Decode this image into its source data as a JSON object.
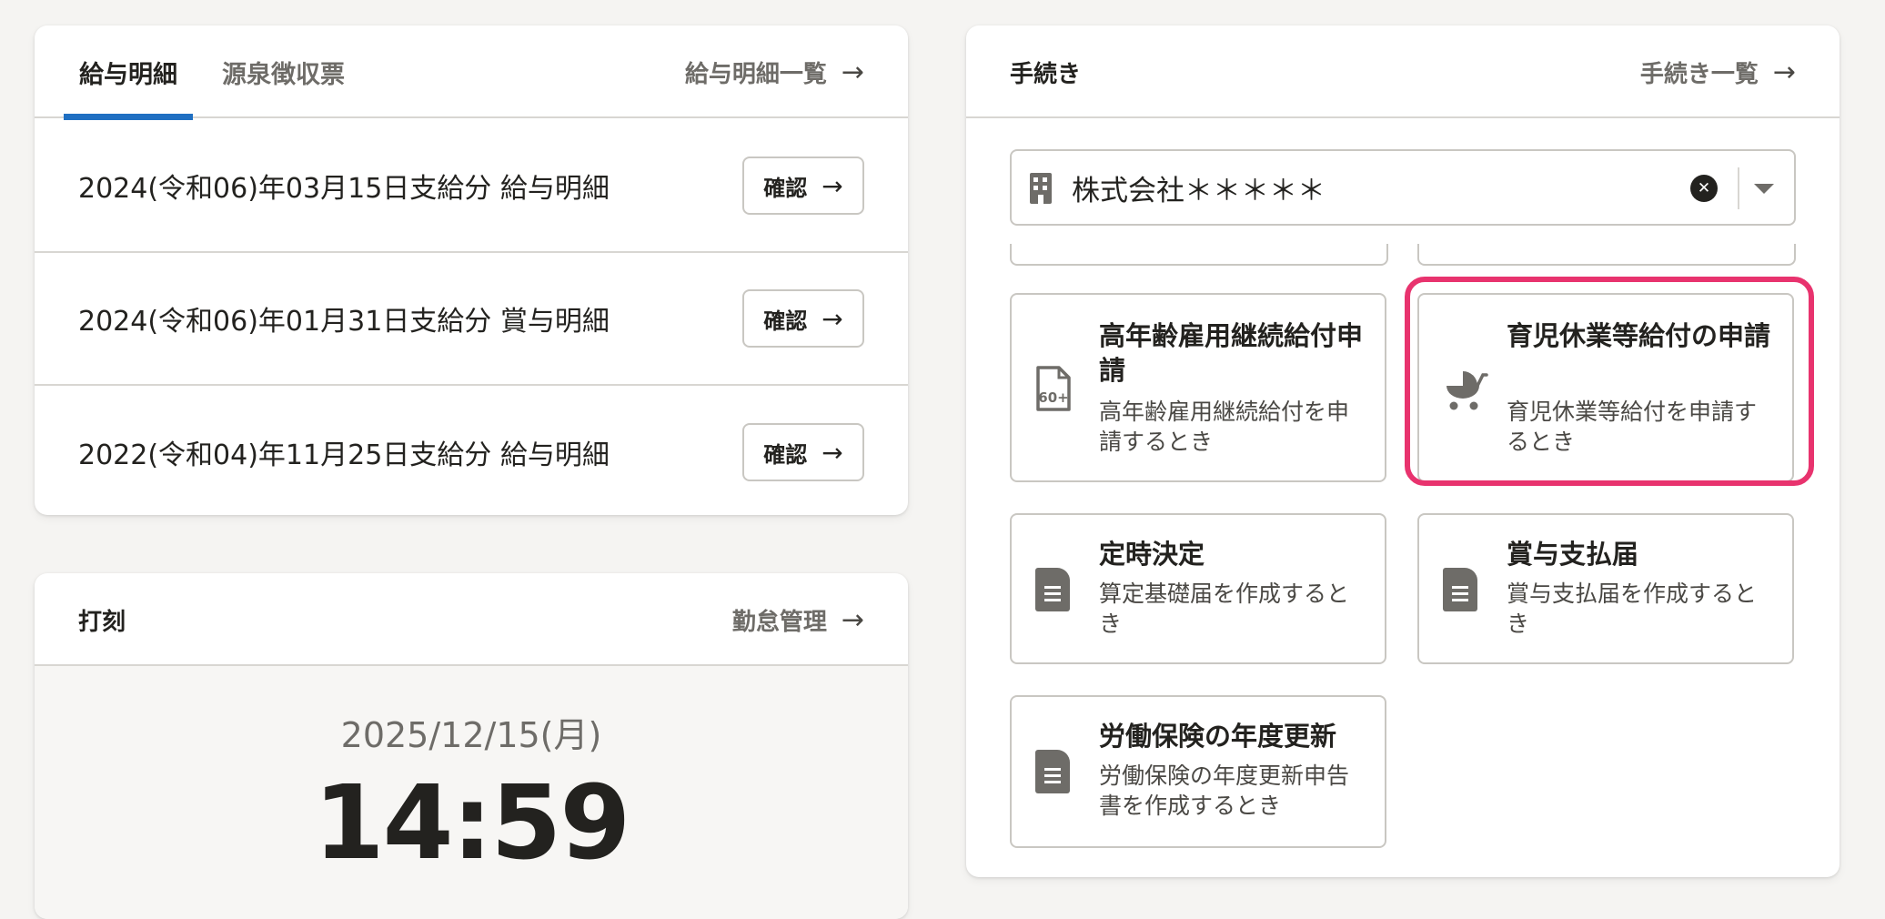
{
  "payslip": {
    "tabs": [
      "給与明細",
      "源泉徴収票"
    ],
    "list_link": "給与明細一覧",
    "rows": [
      {
        "label": "2024(令和06)年03月15日支給分 給与明細",
        "button": "確認"
      },
      {
        "label": "2024(令和06)年01月31日支給分 賞与明細",
        "button": "確認"
      },
      {
        "label": "2022(令和04)年11月25日支給分 給与明細",
        "button": "確認"
      }
    ]
  },
  "clock": {
    "title": "打刻",
    "link": "勤怠管理",
    "date": "2025/12/15(月)",
    "time": "14:59"
  },
  "procedures": {
    "title": "手続き",
    "link": "手続き一覧",
    "company": "株式会社＊＊＊＊＊",
    "tiles": [
      {
        "title": "高年齢雇用継続給付申請",
        "desc": "高年齢雇用継続給付を申請するとき",
        "icon": "document-60plus-icon"
      },
      {
        "title": "育児休業等給付の申請",
        "desc": "育児休業等給付を申請するとき",
        "icon": "baby-stroller-icon",
        "highlighted": true
      },
      {
        "title": "定時決定",
        "desc": "算定基礎届を作成するとき",
        "icon": "document-icon"
      },
      {
        "title": "賞与支払届",
        "desc": "賞与支払届を作成するとき",
        "icon": "document-icon"
      },
      {
        "title": "労働保険の年度更新",
        "desc": "労働保険の年度更新申告書を作成するとき",
        "icon": "document-icon"
      }
    ],
    "highlight_color": "#e8336e"
  },
  "colors": {
    "accent": "#1f6fc2",
    "background": "#f5f4f2"
  }
}
